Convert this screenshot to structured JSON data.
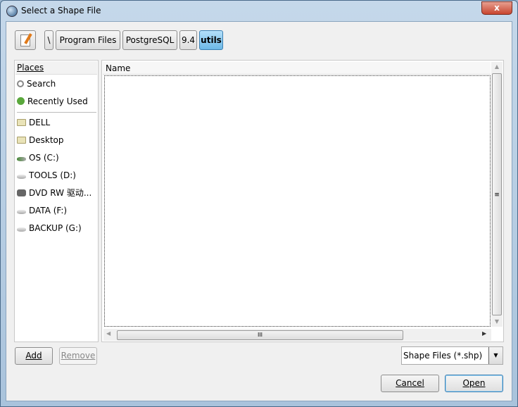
{
  "window": {
    "title": "Select a Shape File",
    "close": "x"
  },
  "toolbar": {
    "edit_icon": "pencil-paper-icon"
  },
  "path": [
    "\\",
    "Program Files",
    "PostgreSQL",
    "9.4",
    "utils"
  ],
  "places": {
    "header": "Places",
    "items": [
      {
        "label": "Search",
        "icon": "search-icon"
      },
      {
        "label": "Recently Used",
        "icon": "recent-icon"
      }
    ],
    "locations": [
      {
        "label": "DELL",
        "icon": "folder-icon"
      },
      {
        "label": "Desktop",
        "icon": "folder-icon"
      },
      {
        "label": "OS (C:)",
        "icon": "drive-icon"
      },
      {
        "label": "TOOLS (D:)",
        "icon": "drive-icon"
      },
      {
        "label": "DVD RW 驱动...",
        "icon": "dvd-icon"
      },
      {
        "label": "DATA (F:)",
        "icon": "drive-icon"
      },
      {
        "label": "BACKUP (G:)",
        "icon": "drive-icon"
      }
    ]
  },
  "files": {
    "column": "Name",
    "rows": []
  },
  "buttons": {
    "add": "Add",
    "remove": "Remove",
    "cancel": "Cancel",
    "open": "Open"
  },
  "filter": {
    "selected": "Shape Files (*.shp)"
  },
  "colors": {
    "selected_path": "#7ec4ef"
  }
}
